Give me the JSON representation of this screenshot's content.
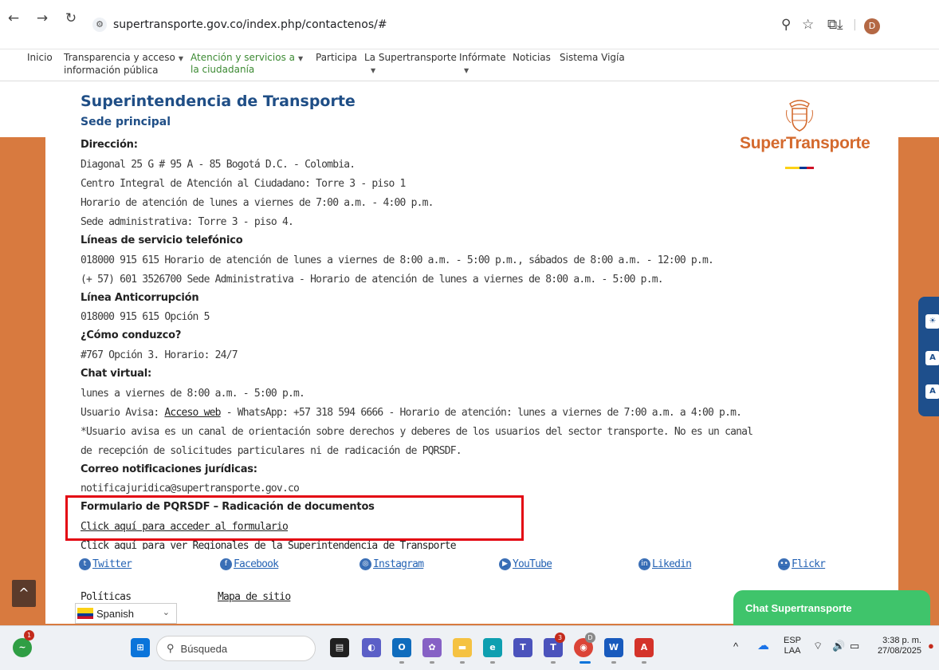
{
  "browser": {
    "url": "supertransporte.gov.co/index.php/contactenos/#",
    "profile_initial": "D"
  },
  "nav": {
    "inicio": "Inicio",
    "transparencia_1": "Transparencia y acceso",
    "transparencia_2": "información pública",
    "atencion_1": "Atención y servicios a",
    "atencion_2": "la ciudadanía",
    "participa": "Participa",
    "supertransporte": "La Supertransporte",
    "informate": "Infórmate",
    "noticias": "Noticias",
    "vigia": "Sistema Vigía"
  },
  "header": {
    "title": "Superintendencia de Transporte",
    "subtitle": "Sede principal",
    "logo_text": "SuperTransporte"
  },
  "content": {
    "direccion_label": "Dirección:",
    "direccion_1": "Diagonal 25 G # 95 A - 85 Bogotá D.C. - Colombia.",
    "direccion_2": "Centro Integral de Atención al Ciudadano: Torre 3 - piso 1",
    "direccion_3": "Horario de atención de lunes a viernes de 7:00 a.m. - 4:00 p.m.",
    "direccion_4": "Sede administrativa: Torre 3 - piso 4.",
    "lineas_label": "Líneas de servicio telefónico",
    "lineas_1": "018000 915 615 Horario de atención de lunes a viernes de 8:00 a.m. - 5:00 p.m., sábados de 8:00 a.m. - 12:00 p.m.",
    "lineas_2": "(+ 57) 601 3526700 Sede Administrativa - Horario de atención de lunes a viernes de 8:00 a.m. - 5:00 p.m.",
    "anticorrupcion_label": "Línea Anticorrupción",
    "anticorrupcion_1": "018000 915 615 Opción 5",
    "conduzco_label": "¿Cómo conduzco?",
    "conduzco_1": "#767 Opción 3. Horario: 24/7",
    "chat_label": "Chat virtual:",
    "chat_1": "lunes a viernes de 8:00 a.m. - 5:00 p.m.",
    "usuario_prefix": "Usuario Avisa: ",
    "usuario_link": "Acceso web",
    "usuario_suffix": " - WhatsApp: +57 318 594 6666 - Horario de atención: lunes a viernes de 7:00 a.m. a 4:00 p.m.",
    "usuario_note_1": "*Usuario avisa es un canal de orientación sobre derechos y deberes de los usuarios del sector transporte. No es un canal",
    "usuario_note_2": "de recepción de solicitudes particulares ni de radicación de PQRSDF.",
    "correo_label": "Correo notificaciones jurídicas:",
    "correo_1": "notificajuridica@supertransporte.gov.co",
    "formulario_label": "Formulario de PQRSDF – Radicación de documentos",
    "formulario_link": "Click aquí para acceder al formulario",
    "regionales_link": "Click aquí para ver Regionales de la Superintendencia de Transporte"
  },
  "social": {
    "twitter": "Twitter",
    "facebook": "Facebook",
    "instagram": "Instagram",
    "youtube": "YouTube",
    "linkedin": "Likedin",
    "flickr": "Flickr"
  },
  "footer": {
    "politicas": "Políticas",
    "mapa": "Mapa de sitio",
    "language": "Spanish",
    "chat_widget": "Chat Supertransporte"
  },
  "taskbar": {
    "search_placeholder": "Búsqueda",
    "teams_badge": "3",
    "chrome_badge": "D",
    "weather_badge": "1",
    "lang_1": "ESP",
    "lang_2": "LAA",
    "time": "3:38 p. m.",
    "date": "27/08/2025"
  },
  "colors": {
    "accent_orange": "#d87a3f",
    "title_blue": "#1f4e86",
    "highlight_red": "#e30613",
    "chat_green": "#3fc46b"
  }
}
